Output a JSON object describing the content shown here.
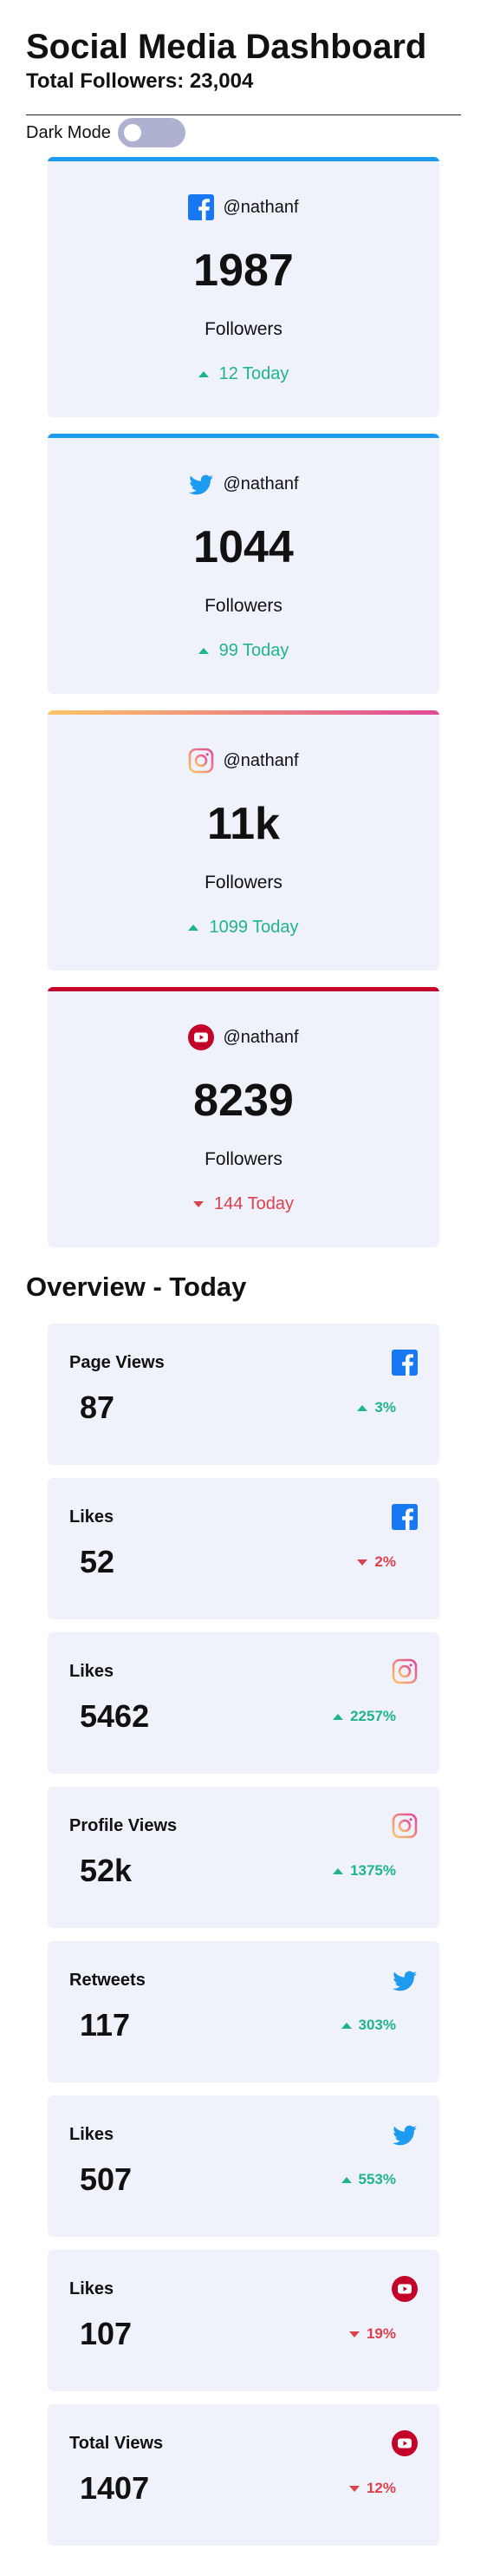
{
  "header": {
    "title": "Social Media Dashboard",
    "total_followers": "Total Followers: 23,004"
  },
  "toggle": {
    "label": "Dark Mode",
    "state": "off"
  },
  "colors": {
    "facebook": "#1d9bf0",
    "twitter": "#1d9bf0",
    "instagram_start": "#fdc468",
    "instagram_end": "#df4996",
    "youtube": "#c4032b",
    "up": "#1eb589",
    "down": "#dc414c"
  },
  "followers": [
    {
      "network": "facebook",
      "icon": "facebook-icon",
      "handle": "@nathanf",
      "count": "1987",
      "label": "Followers",
      "today": "12 Today",
      "trend": "up"
    },
    {
      "network": "twitter",
      "icon": "twitter-icon",
      "handle": "@nathanf",
      "count": "1044",
      "label": "Followers",
      "today": "99 Today",
      "trend": "up"
    },
    {
      "network": "instagram",
      "icon": "instagram-icon",
      "handle": "@nathanf",
      "count": "11k",
      "label": "Followers",
      "today": "1099 Today",
      "trend": "up"
    },
    {
      "network": "youtube",
      "icon": "youtube-icon",
      "handle": "@nathanf",
      "count": "8239",
      "label": "Followers",
      "today": "144 Today",
      "trend": "down"
    }
  ],
  "overview": {
    "title": "Overview - Today",
    "cards": [
      {
        "network": "facebook",
        "icon": "facebook-icon",
        "label": "Page Views",
        "value": "87",
        "change": "3%",
        "trend": "up"
      },
      {
        "network": "facebook",
        "icon": "facebook-icon",
        "label": "Likes",
        "value": "52",
        "change": "2%",
        "trend": "down"
      },
      {
        "network": "instagram",
        "icon": "instagram-icon",
        "label": "Likes",
        "value": "5462",
        "change": "2257%",
        "trend": "up"
      },
      {
        "network": "instagram",
        "icon": "instagram-icon",
        "label": "Profile Views",
        "value": "52k",
        "change": "1375%",
        "trend": "up"
      },
      {
        "network": "twitter",
        "icon": "twitter-icon",
        "label": "Retweets",
        "value": "117",
        "change": "303%",
        "trend": "up"
      },
      {
        "network": "twitter",
        "icon": "twitter-icon",
        "label": "Likes",
        "value": "507",
        "change": "553%",
        "trend": "up"
      },
      {
        "network": "youtube",
        "icon": "youtube-icon",
        "label": "Likes",
        "value": "107",
        "change": "19%",
        "trend": "down"
      },
      {
        "network": "youtube",
        "icon": "youtube-icon",
        "label": "Total Views",
        "value": "1407",
        "change": "12%",
        "trend": "down"
      }
    ]
  }
}
